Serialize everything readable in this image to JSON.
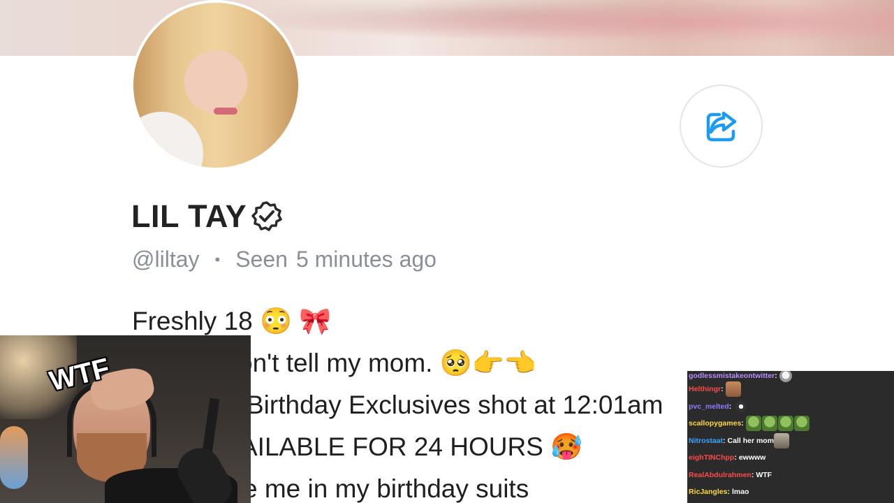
{
  "profile": {
    "name": "LIL TAY",
    "handle": "@liltay",
    "separator": "•",
    "seen_label": "Seen",
    "seen_time": "5 minutes ago",
    "bio": [
      "Freshly 18 😳 🎀",
      "on't tell my mom. 🥺👉👈",
      "Birthday Exclusives shot at 12:01am",
      "AILABLE FOR 24 HOURS 🥵",
      "e me in my birthday suits"
    ]
  },
  "overlay": {
    "reaction_text": "WTF"
  },
  "chat": {
    "messages": [
      {
        "user": "godlessmistakeontwitter",
        "color": "#b98cff",
        "text": "",
        "emotes": [
          "face"
        ]
      },
      {
        "user": "Helthingr",
        "color": "#ff4a4a",
        "text": "",
        "emotes": [
          "man"
        ]
      },
      {
        "user": "pvc_melted",
        "color": "#8f7bff",
        "text": "",
        "emotes": [
          "tiny"
        ]
      },
      {
        "user": "scallopygames",
        "color": "#ffd93b",
        "text": "",
        "emotes": [
          "frog",
          "frog",
          "frog",
          "frog"
        ]
      },
      {
        "user": "Nitrostaat",
        "color": "#3aa3ff",
        "text": "Call her mom",
        "emotes": [
          "cat"
        ]
      },
      {
        "user": "eighTINChpp",
        "color": "#ff4a4a",
        "text": "ewwww",
        "emotes": []
      },
      {
        "user": "RealAbdulrahmen",
        "color": "#ff4a4a",
        "text": "WTF",
        "emotes": []
      },
      {
        "user": "RicJangles",
        "color": "#ffd93b",
        "text": "lmao",
        "emotes": []
      }
    ]
  },
  "colors": {
    "accent": "#1d9bf0",
    "text_primary": "#1f1f1f",
    "text_secondary": "#8a8f97"
  },
  "icons": {
    "share": "share-icon",
    "verified": "verified-badge-icon"
  }
}
